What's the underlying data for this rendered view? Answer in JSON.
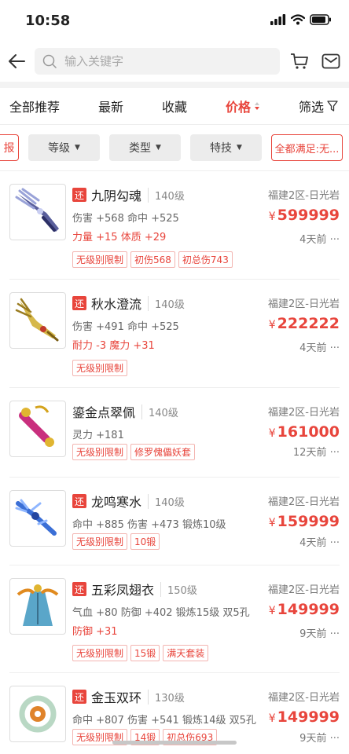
{
  "status": {
    "time": "10:58"
  },
  "search": {
    "placeholder": "输入关键字"
  },
  "sort_tabs": [
    "全部推荐",
    "最新",
    "收藏",
    "价格",
    "筛选"
  ],
  "filters": {
    "partial": "报",
    "level": "等级",
    "type": "类型",
    "skill": "特技",
    "all_match": "全都满足:无..."
  },
  "items": [
    {
      "tag": "还",
      "name": "九阴勾魂",
      "level": "140级",
      "server": "福建2区-日光岩",
      "stats": "伤害 +568 命中 +525",
      "extra": "力量 +15 体质 +29",
      "price": "599999",
      "time": "4天前",
      "badges": [
        "无级别限制",
        "初伤568",
        "初总伤743"
      ]
    },
    {
      "tag": "还",
      "name": "秋水澄流",
      "level": "140级",
      "server": "福建2区-日光岩",
      "stats": "伤害 +491 命中 +525",
      "extra": "耐力 -3 魔力 +31",
      "price": "222222",
      "time": "4天前",
      "badges": [
        "无级别限制"
      ]
    },
    {
      "tag": "",
      "name": "鎏金点翠佩",
      "level": "140级",
      "server": "福建2区-日光岩",
      "stats": "灵力 +181",
      "extra": "",
      "price": "161000",
      "time": "12天前",
      "badges": [
        "无级别限制",
        "修罗傀儡妖套"
      ]
    },
    {
      "tag": "还",
      "name": "龙鸣寒水",
      "level": "140级",
      "server": "福建2区-日光岩",
      "stats": "命中 +885 伤害 +473 锻炼10级",
      "extra": "",
      "price": "159999",
      "time": "4天前",
      "badges": [
        "无级别限制",
        "10锻"
      ]
    },
    {
      "tag": "还",
      "name": "五彩凤翅衣",
      "level": "150级",
      "server": "福建2区-日光岩",
      "stats": "气血 +80 防御 +402 锻炼15级 双5孔",
      "extra": "防御 +31",
      "price": "149999",
      "time": "9天前",
      "badges": [
        "无级别限制",
        "15锻",
        "满天套装"
      ]
    },
    {
      "tag": "还",
      "name": "金玉双环",
      "level": "130级",
      "server": "福建2区-日光岩",
      "stats": "命中 +807 伤害 +541 锻炼14级 双5孔",
      "extra": "",
      "price": "149999",
      "time": "9天前",
      "badges": [
        "无级别限制",
        "14锻",
        "初总伤693"
      ]
    }
  ],
  "currency": "¥",
  "more": "···"
}
